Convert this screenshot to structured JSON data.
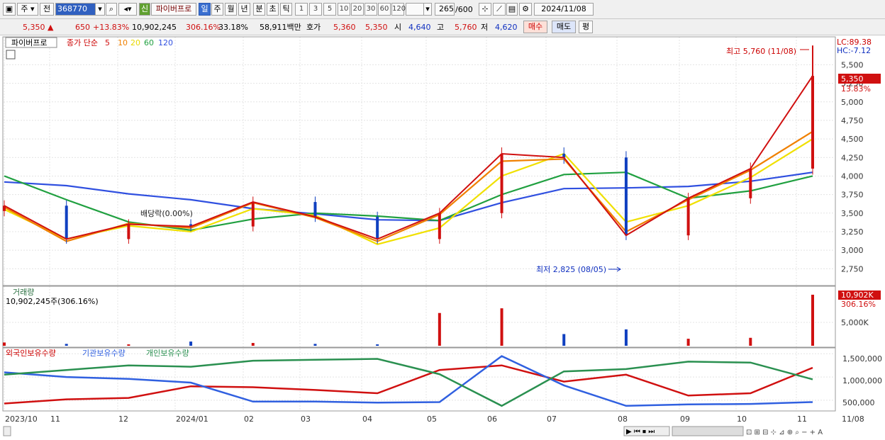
{
  "toolbar": {
    "market": "주",
    "period_label": "전",
    "code": "368770",
    "badge": "신",
    "stock_name": "파이버프로",
    "period_buttons": [
      "일",
      "주",
      "월",
      "년",
      "분",
      "초",
      "틱"
    ],
    "interval_buttons": [
      "1",
      "3",
      "5",
      "10",
      "20",
      "30",
      "60",
      "120"
    ],
    "count": "265",
    "count_max": "/600",
    "date": "2024/11/08"
  },
  "quote": {
    "price": "5,350",
    "change": "650",
    "change_pct": "+13.83%",
    "volume": "10,902,245",
    "volume_ratio": "306.16%",
    "turnover": "33.18%",
    "amount": "58,911백만",
    "hoga_label": "호가",
    "ask": "5,360",
    "bid": "5,350",
    "open_label": "시",
    "open": "4,640",
    "high_label": "고",
    "high": "5,760",
    "low_label": "저",
    "low": "4,620",
    "buy_label": "매수",
    "sell_label": "매도",
    "eval_label": "평"
  },
  "price_panel": {
    "name": "파이버프로",
    "ma_label": "종가 단순",
    "ma_periods": [
      "5",
      "10",
      "20",
      "60",
      "120"
    ],
    "lc": "LC:89.38",
    "hc": "HC:-7.12",
    "high_note": "최고 5,760 (11/08)",
    "low_note": "최저 2,825 (08/05)",
    "dividend_note": "배당락(0.00%)",
    "current_tag": "5,350",
    "current_pct": "13.83%"
  },
  "volume_panel": {
    "title": "거래량",
    "value": "10,902,245주(306.16%)",
    "tag": "10,902K",
    "tag_pct": "306.16%",
    "axis_label": "5,000K"
  },
  "holding_panel": {
    "legend": [
      "외국인보유수량",
      "기관보유수량",
      "개인보유수량"
    ],
    "axis_labels": [
      "1,500,000",
      "1,000,000",
      "500,000"
    ]
  },
  "x_axis_labels": [
    "2023/10",
    "11",
    "12",
    "2024/01",
    "02",
    "03",
    "04",
    "05",
    "06",
    "07",
    "08",
    "09",
    "10",
    "11",
    "11/08"
  ],
  "colors": {
    "up": "#d01010",
    "down": "#1040c0",
    "ma5": "#d01010",
    "ma10": "#f08000",
    "ma20": "#f0e000",
    "ma60": "#20a040",
    "ma120": "#3050e0",
    "foreign": "#d01010",
    "institution": "#3060e0",
    "individual": "#2a9050"
  },
  "chart_data": [
    {
      "type": "candlestick",
      "title": "파이버프로",
      "y_ticks": [
        "5,500",
        "5,250",
        "5,000",
        "4,750",
        "4,500",
        "4,250",
        "4,000",
        "3,750",
        "3,500",
        "3,250",
        "3,000",
        "2,750"
      ],
      "ylim": [
        2600,
        5800
      ],
      "x": [
        "2023/10",
        "11",
        "12",
        "2024/01",
        "02",
        "03",
        "04",
        "05",
        "06",
        "07",
        "08",
        "09",
        "10",
        "11"
      ],
      "close": [
        3600,
        3150,
        3350,
        3320,
        3650,
        3450,
        3150,
        3500,
        4300,
        4250,
        3200,
        3700,
        4100,
        5350
      ],
      "ma5": [
        3580,
        3120,
        3360,
        3300,
        3640,
        3440,
        3120,
        3480,
        4200,
        4230,
        3250,
        3680,
        4080,
        4600
      ],
      "ma20": [
        3550,
        3150,
        3330,
        3250,
        3560,
        3470,
        3080,
        3300,
        4000,
        4300,
        3380,
        3600,
        3980,
        4500
      ],
      "ma60": [
        4000,
        3680,
        3380,
        3270,
        3420,
        3500,
        3460,
        3400,
        3750,
        4020,
        4050,
        3700,
        3800,
        4000
      ],
      "ma120": [
        3920,
        3870,
        3760,
        3680,
        3560,
        3490,
        3410,
        3400,
        3640,
        3830,
        3840,
        3860,
        3930,
        4050
      ],
      "high_marker": {
        "value": 5760,
        "date": "11/08"
      },
      "low_marker": {
        "value": 2825,
        "date": "08/05"
      }
    },
    {
      "type": "bar",
      "title": "거래량",
      "unit": "주",
      "x": [
        "2023/10",
        "11",
        "12",
        "2024/01",
        "02",
        "03",
        "04",
        "05",
        "06",
        "07",
        "08",
        "09",
        "10",
        "11"
      ],
      "values": [
        700000,
        400000,
        300000,
        900000,
        600000,
        400000,
        300000,
        7000000,
        8000000,
        2500000,
        3500000,
        1500000,
        1700000,
        10902245
      ]
    },
    {
      "type": "line",
      "title": "보유수량",
      "x": [
        "2023/10",
        "11",
        "12",
        "2024/01",
        "02",
        "03",
        "04",
        "05",
        "06",
        "07",
        "08",
        "09",
        "10",
        "11"
      ],
      "series": [
        {
          "name": "외국인보유수량",
          "values": [
            430000,
            520000,
            550000,
            800000,
            780000,
            720000,
            650000,
            1150000,
            1250000,
            900000,
            1050000,
            600000,
            650000,
            1200000
          ]
        },
        {
          "name": "기관보유수량",
          "values": [
            1100000,
            1000000,
            960000,
            880000,
            470000,
            470000,
            450000,
            460000,
            1450000,
            820000,
            380000,
            410000,
            420000,
            460000
          ]
        },
        {
          "name": "개인보유수량",
          "values": [
            1050000,
            1150000,
            1250000,
            1220000,
            1350000,
            1370000,
            1390000,
            1060000,
            380000,
            1120000,
            1170000,
            1330000,
            1310000,
            950000
          ]
        }
      ]
    }
  ]
}
